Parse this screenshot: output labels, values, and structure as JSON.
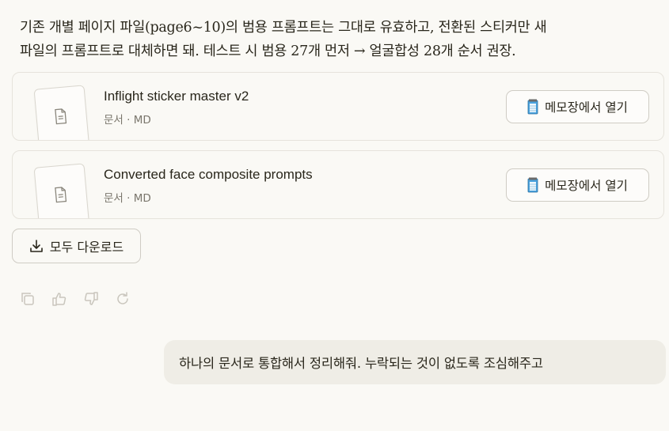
{
  "intro": {
    "line1": "기존 개별 페이지 파일(page6~10)의 범용 프롬프트는 그대로 유효하고, 전환된 스티커만 새",
    "line2": "파일의 프롬프트로 대체하면 돼. 테스트 시 범용 27개 먼저 → 얼굴합성 28개 순서 권장."
  },
  "files": [
    {
      "name": "Inflight sticker master v2",
      "meta": "문서 · MD",
      "open_label": "메모장에서 열기"
    },
    {
      "name": "Converted face composite prompts",
      "meta": "문서 · MD",
      "open_label": "메모장에서 열기"
    }
  ],
  "download_all_label": "모두 다운로드",
  "action_icons": [
    "copy-icon",
    "thumbs-up-icon",
    "thumbs-down-icon",
    "retry-icon"
  ],
  "user_message": "하나의 문서로 통합해서 정리해줘. 누락되는 것이 없도록 조심해주고"
}
